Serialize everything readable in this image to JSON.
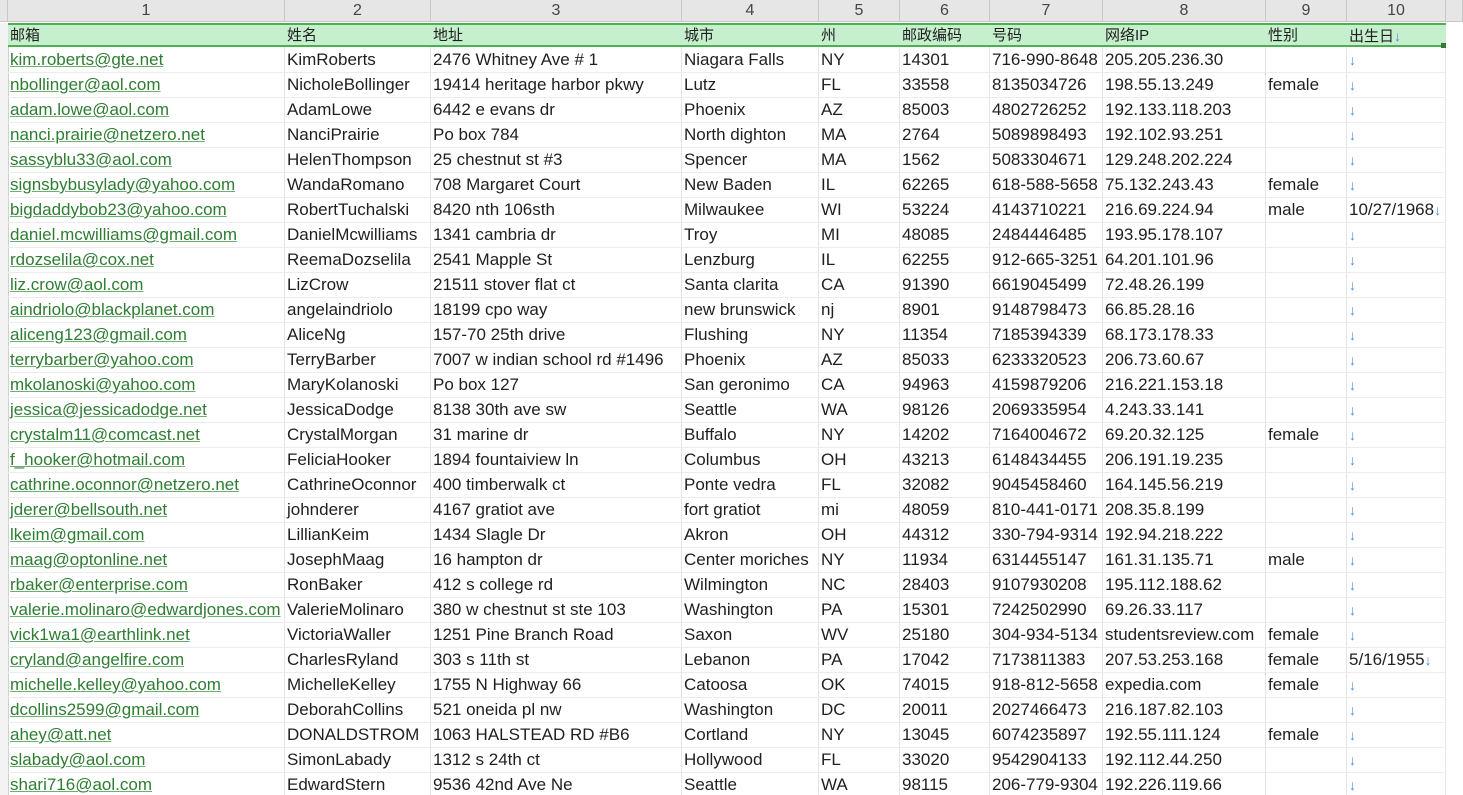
{
  "col_numbers": [
    "1",
    "2",
    "3",
    "4",
    "5",
    "6",
    "7",
    "8",
    "9",
    "10"
  ],
  "headers": [
    "邮箱",
    "姓名",
    "地址",
    "城市",
    "州",
    "邮政编码",
    "号码",
    "网络IP",
    "性别",
    "出生日"
  ],
  "rows": [
    [
      "kim.roberts@gte.net",
      "KimRoberts",
      "2476 Whitney Ave # 1",
      "Niagara Falls",
      "NY",
      "14301",
      "716-990-8648",
      "205.205.236.30",
      "",
      ""
    ],
    [
      "nbollinger@aol.com",
      "NicholeBollinger",
      "19414 heritage harbor pkwy",
      "Lutz",
      "FL",
      "33558",
      "8135034726",
      "198.55.13.249",
      "female",
      ""
    ],
    [
      "adam.lowe@aol.com",
      "AdamLowe",
      "6442 e evans dr",
      "Phoenix",
      "AZ",
      "85003",
      "4802726252",
      "192.133.118.203",
      "",
      ""
    ],
    [
      "nanci.prairie@netzero.net",
      "NanciPrairie",
      "Po box 784",
      "North dighton",
      "MA",
      "2764",
      "5089898493",
      "192.102.93.251",
      "",
      ""
    ],
    [
      "sassyblu33@aol.com",
      "HelenThompson",
      "25 chestnut st #3",
      "Spencer",
      "MA",
      "1562",
      "5083304671",
      "129.248.202.224",
      "",
      ""
    ],
    [
      "signsbybusylady@yahoo.com",
      "WandaRomano",
      "708 Margaret Court",
      "New Baden",
      "IL",
      "62265",
      "618-588-5658",
      "75.132.243.43",
      "female",
      ""
    ],
    [
      "bigdaddybob23@yahoo.com",
      "RobertTuchalski",
      "8420 nth 106sth",
      "Milwaukee",
      "WI",
      "53224",
      "4143710221",
      "216.69.224.94",
      "male",
      "10/27/1968"
    ],
    [
      "daniel.mcwilliams@gmail.com",
      "DanielMcwilliams",
      "1341 cambria dr",
      "Troy",
      "MI",
      "48085",
      "2484446485",
      "193.95.178.107",
      "",
      ""
    ],
    [
      "rdozselila@cox.net",
      "ReemaDozselila",
      "2541 Mapple St",
      "Lenzburg",
      "IL",
      "62255",
      "912-665-3251",
      "64.201.101.96",
      "",
      ""
    ],
    [
      "liz.crow@aol.com",
      "LizCrow",
      "21511 stover flat ct",
      "Santa clarita",
      "CA",
      "91390",
      "6619045499",
      "72.48.26.199",
      "",
      ""
    ],
    [
      "aindriolo@blackplanet.com",
      "angelaindriolo",
      "18199 cpo way",
      "new brunswick",
      "nj",
      "8901",
      "9148798473",
      "66.85.28.16",
      "",
      ""
    ],
    [
      "aliceng123@gmail.com",
      "AliceNg",
      "157-70 25th drive",
      "Flushing",
      "NY",
      "11354",
      "7185394339",
      "68.173.178.33",
      "",
      ""
    ],
    [
      "terrybarber@yahoo.com",
      "TerryBarber",
      "7007 w indian school rd #1496",
      "Phoenix",
      "AZ",
      "85033",
      "6233320523",
      "206.73.60.67",
      "",
      ""
    ],
    [
      "mkolanoski@yahoo.com",
      "MaryKolanoski",
      "Po box 127",
      "San geronimo",
      "CA",
      "94963",
      "4159879206",
      "216.221.153.18",
      "",
      ""
    ],
    [
      "jessica@jessicadodge.net",
      "JessicaDodge",
      "8138 30th ave sw",
      "Seattle",
      "WA",
      "98126",
      "2069335954",
      "4.243.33.141",
      "",
      ""
    ],
    [
      "crystalm11@comcast.net",
      "CrystalMorgan",
      "31 marine dr",
      "Buffalo",
      "NY",
      "14202",
      "7164004672",
      "69.20.32.125",
      "female",
      ""
    ],
    [
      "f_hooker@hotmail.com",
      "FeliciaHooker",
      "1894 fountaiview ln",
      "Columbus",
      "OH",
      "43213",
      "6148434455",
      "206.191.19.235",
      "",
      ""
    ],
    [
      "cathrine.oconnor@netzero.net",
      "CathrineOconnor",
      "400 timberwalk ct",
      "Ponte vedra",
      "FL",
      "32082",
      "9045458460",
      "164.145.56.219",
      "",
      ""
    ],
    [
      "jderer@bellsouth.net",
      "johnderer",
      "4167 gratiot ave",
      "fort gratiot",
      "mi",
      "48059",
      "810-441-0171",
      "208.35.8.199",
      "",
      ""
    ],
    [
      "lkeim@gmail.com",
      "LillianKeim",
      "1434 Slagle Dr",
      "Akron",
      "OH",
      "44312",
      "330-794-9314",
      "192.94.218.222",
      "",
      ""
    ],
    [
      "maag@optonline.net",
      "JosephMaag",
      "16 hampton dr",
      "Center moriches",
      "NY",
      "11934",
      "6314455147",
      "161.31.135.71",
      "male",
      ""
    ],
    [
      "rbaker@enterprise.com",
      "RonBaker",
      "412 s college rd",
      "Wilmington",
      "NC",
      "28403",
      "9107930208",
      "195.112.188.62",
      "",
      ""
    ],
    [
      "valerie.molinaro@edwardjones.com",
      "ValerieMolinaro",
      "380 w chestnut st ste 103",
      "Washington",
      "PA",
      "15301",
      "7242502990",
      "69.26.33.117",
      "",
      ""
    ],
    [
      "vick1wa1@earthlink.net",
      "VictoriaWaller",
      "1251 Pine Branch Road",
      "Saxon",
      "WV",
      "25180",
      "304-934-5134",
      "studentsreview.com",
      "female",
      ""
    ],
    [
      "cryland@angelfire.com",
      "CharlesRyland",
      "303 s 11th st",
      "Lebanon",
      "PA",
      "17042",
      "7173811383",
      "207.53.253.168",
      "female",
      "5/16/1955"
    ],
    [
      "michelle.kelley@yahoo.com",
      "MichelleKelley",
      "1755 N Highway 66",
      "Catoosa",
      "OK",
      "74015",
      "918-812-5658",
      "expedia.com",
      "female",
      ""
    ],
    [
      "dcollins2599@gmail.com",
      "DeborahCollins",
      "521 oneida pl nw",
      "Washington",
      "DC",
      "20011",
      "2027466473",
      "216.187.82.103",
      "",
      ""
    ],
    [
      "ahey@att.net",
      "DONALDSTROM",
      "1063 HALSTEAD RD #B6",
      "Cortland",
      "NY",
      "13045",
      "6074235897",
      "192.55.111.124",
      "female",
      ""
    ],
    [
      "slabady@aol.com",
      "SimonLabady",
      "1312 s 24th ct",
      "Hollywood",
      "FL",
      "33020",
      "9542904133",
      "192.112.44.250",
      "",
      ""
    ],
    [
      "shari716@aol.com",
      "EdwardStern",
      "9536 42nd Ave Ne",
      "Seattle",
      "WA",
      "98115",
      "206-779-9304",
      "192.226.119.66",
      "",
      ""
    ]
  ],
  "arrow_glyph": "↓",
  "colors": {
    "header_fill": "#c6efce",
    "email_text": "#2e7d32",
    "arrow": "#4a90d9",
    "selection_border": "#4caf50"
  }
}
